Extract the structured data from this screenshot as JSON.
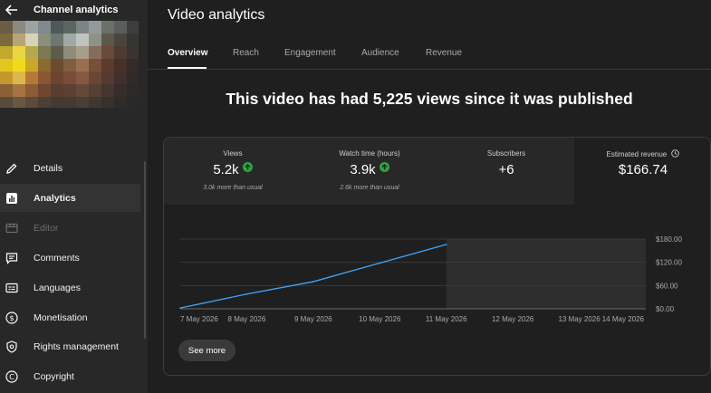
{
  "sidebar": {
    "title": "Channel analytics",
    "items": [
      {
        "label": "Details",
        "icon": "pencil-icon",
        "active": false,
        "disabled": false
      },
      {
        "label": "Analytics",
        "icon": "analytics-icon",
        "active": true,
        "disabled": false
      },
      {
        "label": "Editor",
        "icon": "editor-icon",
        "active": false,
        "disabled": true
      },
      {
        "label": "Comments",
        "icon": "comments-icon",
        "active": false,
        "disabled": false
      },
      {
        "label": "Languages",
        "icon": "subtitles-icon",
        "active": false,
        "disabled": false
      },
      {
        "label": "Monetisation",
        "icon": "dollar-icon",
        "active": false,
        "disabled": false
      },
      {
        "label": "Rights management",
        "icon": "shield-icon",
        "active": false,
        "disabled": false
      },
      {
        "label": "Copyright",
        "icon": "copyright-icon",
        "active": false,
        "disabled": false
      }
    ]
  },
  "main": {
    "title": "Video analytics",
    "tabs": [
      {
        "label": "Overview",
        "active": true
      },
      {
        "label": "Reach",
        "active": false
      },
      {
        "label": "Engagement",
        "active": false
      },
      {
        "label": "Audience",
        "active": false
      },
      {
        "label": "Revenue",
        "active": false
      }
    ],
    "headline": "This video has had 5,225 views since it was published",
    "metrics": [
      {
        "label": "Views",
        "value": "5.2k",
        "sub": "3.0k more than usual",
        "trend": "up"
      },
      {
        "label": "Watch time (hours)",
        "value": "3.9k",
        "sub": "2.6k more than usual",
        "trend": "up"
      },
      {
        "label": "Subscribers",
        "value": "+6",
        "sub": "",
        "trend": ""
      },
      {
        "label": "Estimated revenue",
        "value": "$166.74",
        "sub": "",
        "trend": "",
        "info_icon": "clock-icon"
      }
    ],
    "see_more": "See more"
  },
  "colors": {
    "line": "#3ea6ff",
    "trend_up": "#2ba640",
    "background": "#1f1f1f",
    "card": "#282828"
  },
  "chart_data": {
    "type": "line",
    "x": [
      "7 May 2026",
      "8 May 2026",
      "9 May 2026",
      "10 May 2026",
      "11 May 2026",
      "12 May 2026",
      "13 May 2026",
      "14 May 2026"
    ],
    "series": [
      {
        "values": [
          2,
          38,
          70,
          118,
          166
        ]
      }
    ],
    "y_ticks": [
      "$0.00",
      "$60.00",
      "$120.00",
      "$180.00"
    ],
    "ylim": [
      0,
      180
    ],
    "future_region_from": "11 May 2026",
    "grid": true
  }
}
